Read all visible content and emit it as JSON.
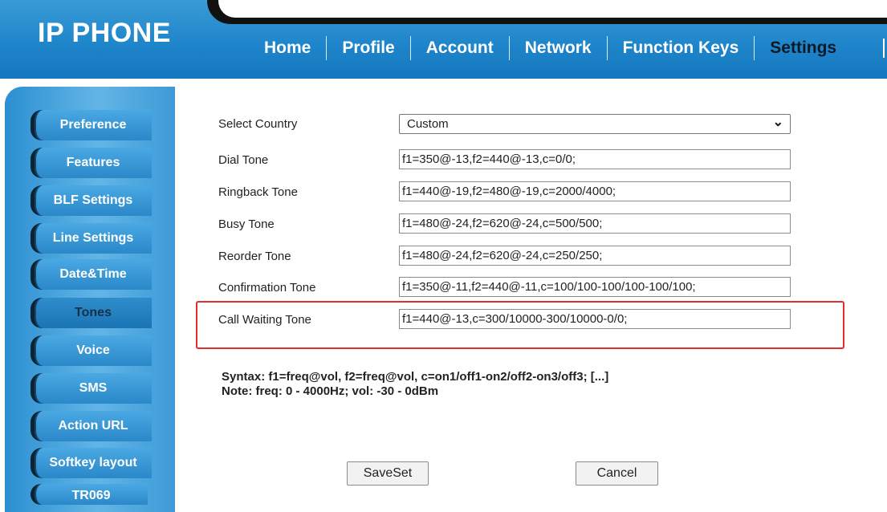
{
  "header": {
    "logo": "IP PHONE",
    "nav": [
      "Home",
      "Profile",
      "Account",
      "Network",
      "Function Keys",
      "Settings"
    ],
    "active": "Settings"
  },
  "sidebar": {
    "items": [
      "Preference",
      "Features",
      "BLF Settings",
      "Line Settings",
      "Date&Time",
      "Tones",
      "Voice",
      "SMS",
      "Action URL",
      "Softkey layout",
      "TR069"
    ],
    "active": "Tones"
  },
  "form": {
    "country_label": "Select Country",
    "country_value": "Custom",
    "rows": [
      {
        "label": "Dial Tone",
        "value": "f1=350@-13,f2=440@-13,c=0/0;"
      },
      {
        "label": "Ringback Tone",
        "value": "f1=440@-19,f2=480@-19,c=2000/4000;"
      },
      {
        "label": "Busy Tone",
        "value": "f1=480@-24,f2=620@-24,c=500/500;"
      },
      {
        "label": "Reorder Tone",
        "value": "f1=480@-24,f2=620@-24,c=250/250;"
      },
      {
        "label": "Confirmation Tone",
        "value": "f1=350@-11,f2=440@-11,c=100/100-100/100-100/100;"
      },
      {
        "label": "Call Waiting Tone",
        "value": "f1=440@-13,c=300/10000-300/10000-0/0;"
      }
    ]
  },
  "help": {
    "syntax": "Syntax: f1=freq@vol, f2=freq@vol, c=on1/off1-on2/off2-on3/off3; [...]",
    "note": "Note: freq: 0 - 4000Hz; vol: -30 - 0dBm"
  },
  "buttons": {
    "save": "SaveSet",
    "cancel": "Cancel"
  },
  "colors": {
    "header_blue": "#1f86cb",
    "highlight_red": "#e02d2d"
  }
}
